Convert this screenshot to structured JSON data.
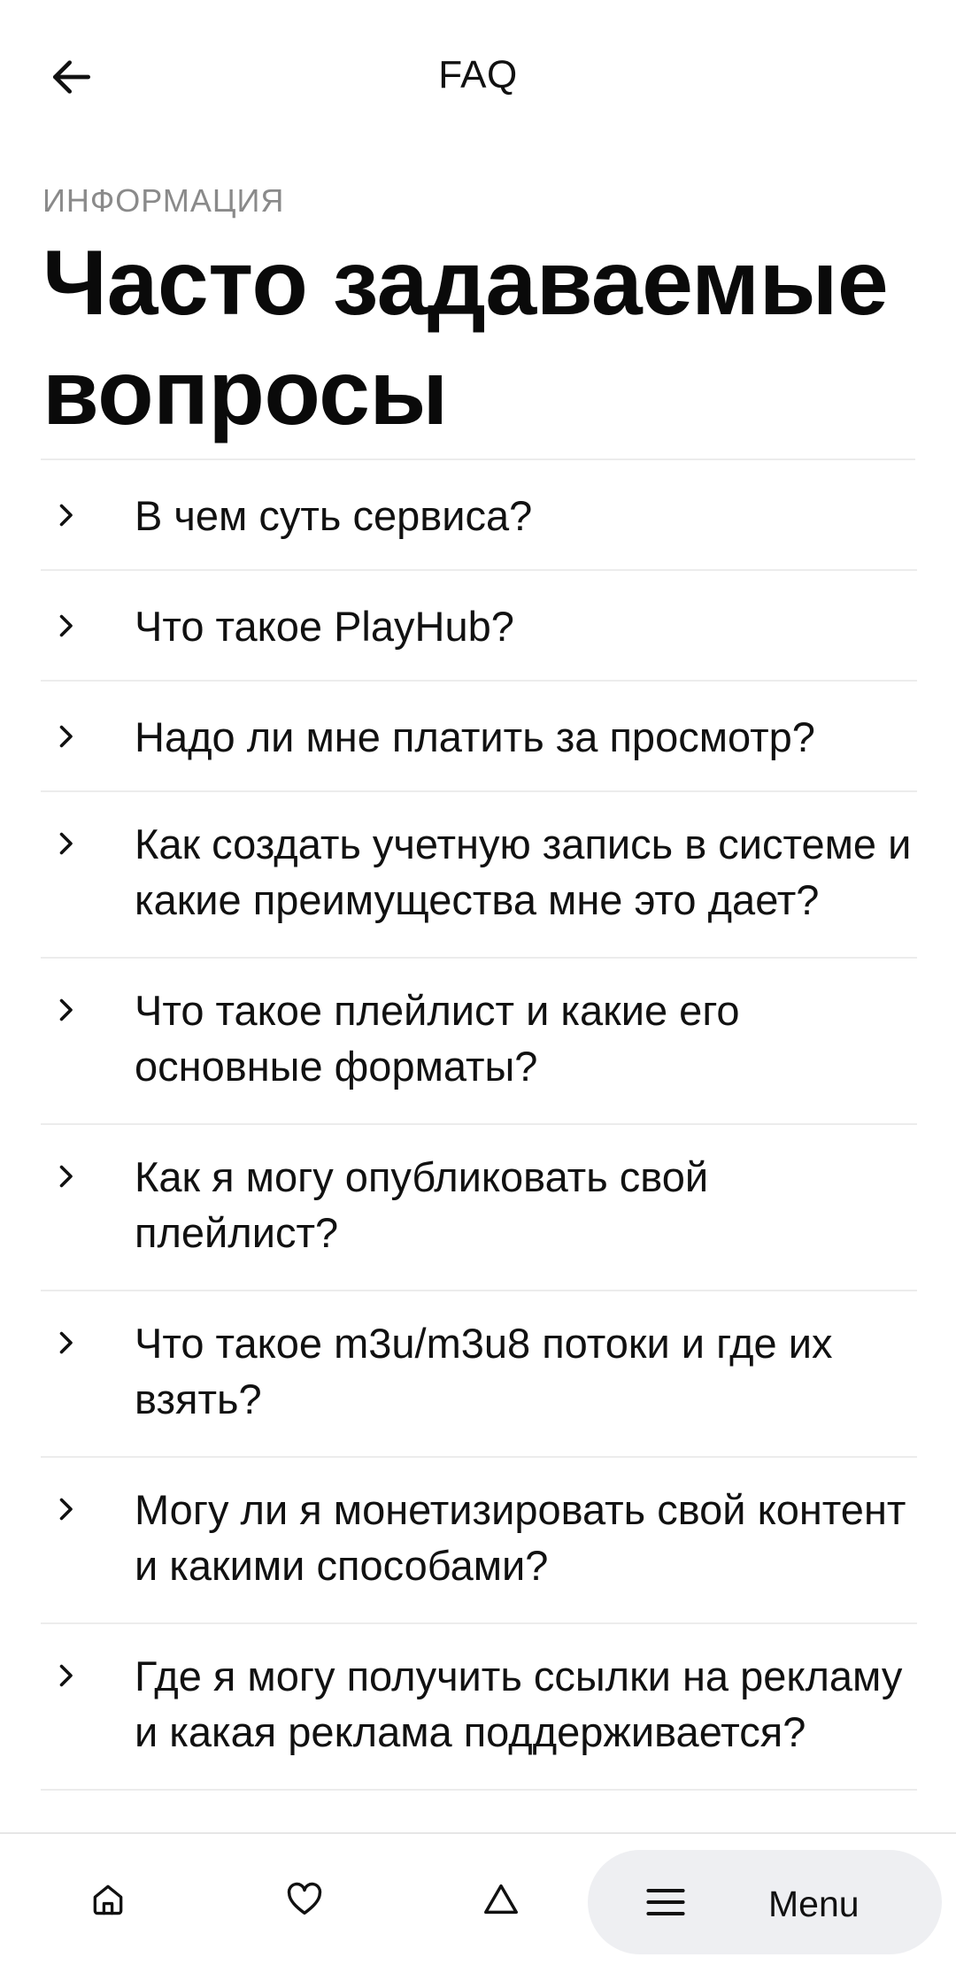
{
  "header": {
    "title": "FAQ",
    "back_icon": "arrow-left-icon"
  },
  "section": {
    "eyebrow": "ИНФОРМАЦИЯ",
    "title": "Часто задаваемые вопросы"
  },
  "faq": {
    "items": [
      {
        "question": "В чем суть сервиса?"
      },
      {
        "question": "Что такое PlayHub?"
      },
      {
        "question": "Надо ли мне платить за просмотр?"
      },
      {
        "question": "Как создать учетную запись в системе и какие преимущества мне это дает?"
      },
      {
        "question": "Что такое плейлист и какие его основные форматы?"
      },
      {
        "question": "Как я могу опубликовать свой плейлист?"
      },
      {
        "question": "Что такое m3u/m3u8 потоки и где их взять?"
      },
      {
        "question": "Могу ли я монетизировать свой контент и какими способами?"
      },
      {
        "question": "Где я могу получить ссылки на рекламу и какая реклама поддерживается?"
      }
    ]
  },
  "bottom_nav": {
    "home_icon": "home-icon",
    "favorites_icon": "heart-icon",
    "alerts_icon": "triangle-icon",
    "menu_icon": "hamburger-icon",
    "menu_label": "Menu",
    "menu_pill_color": "#eeeff2"
  }
}
